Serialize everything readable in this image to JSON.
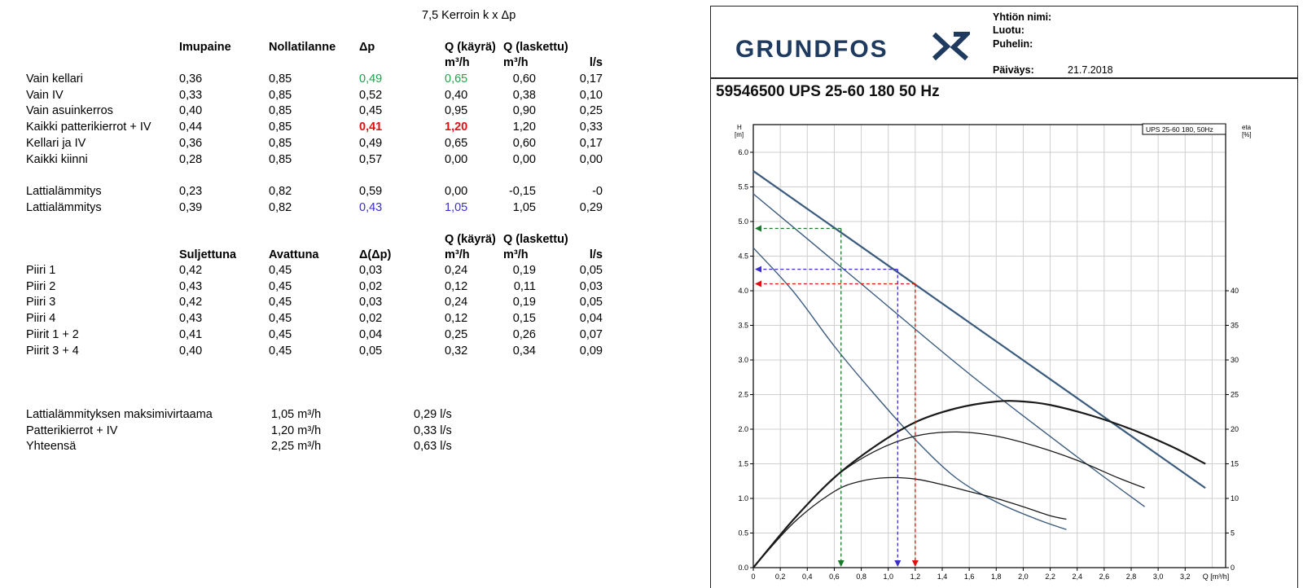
{
  "sheet": {
    "kerroin_label": "7,5  Kerroin k x Δp",
    "table1": {
      "headers": [
        "Imupaine",
        "Nollatilanne",
        "Δp",
        "Q (käyrä)",
        "Q (laskettu)"
      ],
      "units": [
        "m³/h",
        "m³/h",
        "l/s"
      ],
      "rows": [
        {
          "label": "Vain kellari",
          "cells": [
            "0,36",
            "0,85",
            "0,49",
            "0,65",
            "0,60",
            "0,17"
          ],
          "highlight": "green"
        },
        {
          "label": "Vain IV",
          "cells": [
            "0,33",
            "0,85",
            "0,52",
            "0,40",
            "0,38",
            "0,10"
          ],
          "highlight": ""
        },
        {
          "label": "Vain asuinkerros",
          "cells": [
            "0,40",
            "0,85",
            "0,45",
            "0,95",
            "0,90",
            "0,25"
          ],
          "highlight": ""
        },
        {
          "label": "Kaikki patterikierrot + IV",
          "cells": [
            "0,44",
            "0,85",
            "0,41",
            "1,20",
            "1,20",
            "0,33"
          ],
          "highlight": "red"
        },
        {
          "label": "Kellari ja IV",
          "cells": [
            "0,36",
            "0,85",
            "0,49",
            "0,65",
            "0,60",
            "0,17"
          ],
          "highlight": ""
        },
        {
          "label": "Kaikki kiinni",
          "cells": [
            "0,28",
            "0,85",
            "0,57",
            "0,00",
            "0,00",
            "0,00"
          ],
          "highlight": ""
        }
      ]
    },
    "table2": {
      "rows": [
        {
          "label": "Lattialämmitys",
          "cells": [
            "0,23",
            "0,82",
            "0,59",
            "0,00",
            "-0,15",
            "-0"
          ],
          "highlight": ""
        },
        {
          "label": "Lattialämmitys",
          "cells": [
            "0,39",
            "0,82",
            "0,43",
            "1,05",
            "1,05",
            "0,29"
          ],
          "highlight": "blue"
        }
      ]
    },
    "table3": {
      "headers": [
        "Suljettuna",
        "Avattuna",
        "Δ(Δp)",
        "Q (käyrä)",
        "Q (laskettu)"
      ],
      "units": [
        "m³/h",
        "m³/h",
        "l/s"
      ],
      "rows": [
        {
          "label": "Piiri 1",
          "cells": [
            "0,42",
            "0,45",
            "0,03",
            "0,24",
            "0,19",
            "0,05"
          ]
        },
        {
          "label": "Piiri 2",
          "cells": [
            "0,43",
            "0,45",
            "0,02",
            "0,12",
            "0,11",
            "0,03"
          ]
        },
        {
          "label": "Piiri 3",
          "cells": [
            "0,42",
            "0,45",
            "0,03",
            "0,24",
            "0,19",
            "0,05"
          ]
        },
        {
          "label": "Piiri 4",
          "cells": [
            "0,43",
            "0,45",
            "0,02",
            "0,12",
            "0,15",
            "0,04"
          ]
        },
        {
          "label": "Piirit 1 + 2",
          "cells": [
            "0,41",
            "0,45",
            "0,04",
            "0,25",
            "0,26",
            "0,07"
          ]
        },
        {
          "label": "Piirit 3 + 4",
          "cells": [
            "0,40",
            "0,45",
            "0,05",
            "0,32",
            "0,34",
            "0,09"
          ]
        }
      ]
    },
    "summary": [
      {
        "label": "Lattialämmityksen maksimivirtaama",
        "flow": "1,05 m³/h",
        "ls": "0,29  l/s"
      },
      {
        "label": "Patterikierrot + IV",
        "flow": "1,20 m³/h",
        "ls": "0,33  l/s"
      },
      {
        "label": "Yhteensä",
        "flow": "2,25 m³/h",
        "ls": "0,63  l/s"
      }
    ]
  },
  "datasheet": {
    "logo_text": "GRUNDFOS",
    "fields": {
      "company_label": "Yhtiön nimi:",
      "created_label": "Luotu:",
      "phone_label": "Puhelin:",
      "date_label": "Päiväys:",
      "date_value": "21.7.2018"
    },
    "model_title": "59546500 UPS 25-60 180 50 Hz"
  },
  "chart_data": {
    "type": "line",
    "legend_box": "UPS 25-60 180, 50Hz",
    "y_left_label": [
      "H",
      "[m]"
    ],
    "y_right_label": [
      "eta",
      "[%]"
    ],
    "x_label": "Q [m³/h]",
    "xlim": [
      0,
      3.5
    ],
    "ylim": [
      0,
      6.4
    ],
    "y2lim": [
      0,
      64
    ],
    "x_ticks": [
      "0",
      "0,2",
      "0,4",
      "0,6",
      "0,8",
      "1,0",
      "1,2",
      "1,4",
      "1,6",
      "1,8",
      "2,0",
      "2,2",
      "2,4",
      "2,6",
      "2,8",
      "3,0",
      "3,2"
    ],
    "y_ticks": [
      "0.0",
      "0.5",
      "1.0",
      "1.5",
      "2.0",
      "2.5",
      "3.0",
      "3.5",
      "4.0",
      "4.5",
      "5.0",
      "5.5",
      "6.0"
    ],
    "y2_ticks": [
      "0",
      "5",
      "10",
      "15",
      "20",
      "25",
      "30",
      "35",
      "40"
    ],
    "grid": true,
    "head_curves": [
      {
        "bold": true,
        "x": [
          0,
          3.35
        ],
        "y": [
          5.73,
          1.15
        ]
      },
      {
        "bold": false,
        "x": [
          0,
          0.8,
          1.6,
          2.4,
          2.9
        ],
        "y": [
          5.4,
          4.1,
          2.8,
          1.6,
          0.88
        ]
      },
      {
        "bold": false,
        "x": [
          0,
          0.3,
          0.6,
          0.9,
          1.2,
          1.5,
          1.8,
          2.1,
          2.32
        ],
        "y": [
          4.62,
          3.98,
          3.2,
          2.5,
          1.85,
          1.3,
          0.95,
          0.7,
          0.55
        ]
      }
    ],
    "efficiency_curves": [
      {
        "bold": true,
        "x": [
          0,
          0.3,
          0.6,
          0.9,
          1.2,
          1.5,
          1.8,
          2.0,
          2.2,
          2.5,
          2.8,
          3.1,
          3.35
        ],
        "y": [
          0,
          7,
          13,
          17.5,
          21,
          23,
          24,
          24,
          23.5,
          22,
          20,
          17.5,
          15
        ]
      },
      {
        "bold": false,
        "x": [
          0,
          0.3,
          0.6,
          0.9,
          1.2,
          1.5,
          1.8,
          2.1,
          2.4,
          2.7,
          2.9
        ],
        "y": [
          0,
          7,
          13,
          16.8,
          19,
          19.6,
          19,
          17.5,
          15.5,
          13,
          11.5
        ]
      },
      {
        "bold": false,
        "x": [
          0,
          0.3,
          0.6,
          0.8,
          1.0,
          1.2,
          1.4,
          1.6,
          1.8,
          2.0,
          2.2,
          2.32
        ],
        "y": [
          0,
          6.5,
          11,
          12.5,
          13,
          12.8,
          12,
          11,
          10,
          8.8,
          7.5,
          7
        ]
      }
    ],
    "markers": [
      {
        "color": "#1a7a2c",
        "q": 0.65,
        "h": 4.9
      },
      {
        "color": "#3a2fc8",
        "q": 1.07,
        "h": 4.31
      },
      {
        "color": "#e01010",
        "q": 1.2,
        "h": 4.1
      }
    ],
    "colors": {
      "head": "#3b5b7e",
      "efficiency": "#1a1a1a",
      "grid": "#cfcfcf"
    }
  }
}
